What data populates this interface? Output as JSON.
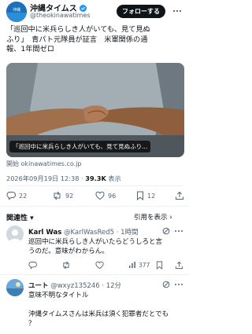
{
  "post": {
    "author_name": "沖縄タイムス",
    "author_handle": "@theokinawatimes",
    "follow_label": "フォローする",
    "text_line1": "「巡回中に米兵らしき人がいても、見て見ぬ",
    "text_line2": "ふり」　青パト元隊員が証言　米軍関係の通",
    "text_line3": "報、1年間ゼロ",
    "image_caption": "「巡回中に米兵らしき人がいても、見て見ぬふり...",
    "link_source": "開始 okinawatimes.co.jp",
    "timestamp": "2026年09月19日 12:38 · ",
    "views": "39.3K",
    "views_label": " 表示",
    "stats": {
      "replies": "22",
      "reposts": "92",
      "likes": "96",
      "bookmarks": "12"
    }
  },
  "related": {
    "label": "関連性 ▾",
    "quote_label": "引用を表示 ›"
  },
  "replies": [
    {
      "name": "Karl Was",
      "handle_time": "@KarlWasRed5 · 1時間",
      "text_line1": "巡回中に米兵らしき人がいたらどうしろと言",
      "text_line2": "うのだ。意味がわからん。",
      "views": "377"
    },
    {
      "name": "ユート",
      "handle_time": "@wxyz135246 · 12分",
      "text_line1": "意味不明なタイトル",
      "text_line2": "沖縄タイムスさんは米兵は須く犯罪者だとでも",
      "text_line3": "？"
    }
  ],
  "colors": {
    "accent": "#1d9bf0",
    "muted": "#536471",
    "divider": "#eff3f4"
  }
}
